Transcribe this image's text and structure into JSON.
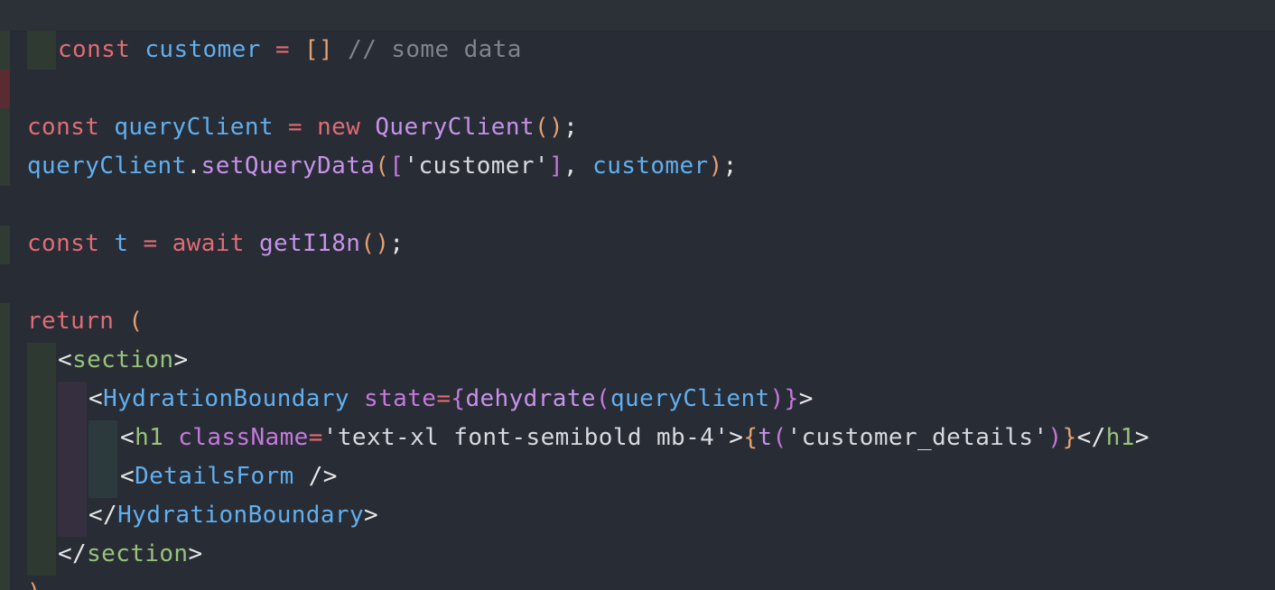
{
  "editor": {
    "language_hint_colors": {
      "background": "#282c34",
      "keyword": "#e06c75",
      "identifier": "#61afef",
      "function": "#c792ea",
      "string": "#d7dae0",
      "comment": "#7f848e",
      "tag": "#98c379"
    },
    "lines": [
      {
        "tokens": [
          {
            "t": "const",
            "c": "kw"
          },
          {
            "t": " ",
            "c": "punc"
          },
          {
            "t": "customer",
            "c": "var"
          },
          {
            "t": " ",
            "c": "punc"
          },
          {
            "t": "=",
            "c": "op"
          },
          {
            "t": " ",
            "c": "punc"
          },
          {
            "t": "[]",
            "c": "brk"
          },
          {
            "t": " ",
            "c": "punc"
          },
          {
            "t": "// some data",
            "c": "cmt"
          }
        ]
      },
      {
        "tokens": []
      },
      {
        "tokens": [
          {
            "t": "const",
            "c": "kw"
          },
          {
            "t": " ",
            "c": "punc"
          },
          {
            "t": "queryClient",
            "c": "var"
          },
          {
            "t": " ",
            "c": "punc"
          },
          {
            "t": "=",
            "c": "op"
          },
          {
            "t": " ",
            "c": "punc"
          },
          {
            "t": "new",
            "c": "kw"
          },
          {
            "t": " ",
            "c": "punc"
          },
          {
            "t": "QueryClient",
            "c": "fn"
          },
          {
            "t": "()",
            "c": "brk"
          },
          {
            "t": ";",
            "c": "white"
          }
        ]
      },
      {
        "tokens": [
          {
            "t": "queryClient",
            "c": "var"
          },
          {
            "t": ".",
            "c": "white"
          },
          {
            "t": "setQueryData",
            "c": "fn"
          },
          {
            "t": "(",
            "c": "brk"
          },
          {
            "t": "[",
            "c": "brk2"
          },
          {
            "t": "'customer'",
            "c": "str2"
          },
          {
            "t": "]",
            "c": "brk2"
          },
          {
            "t": ", ",
            "c": "white"
          },
          {
            "t": "customer",
            "c": "var"
          },
          {
            "t": ")",
            "c": "brk"
          },
          {
            "t": ";",
            "c": "white"
          }
        ]
      },
      {
        "tokens": []
      },
      {
        "tokens": [
          {
            "t": "const",
            "c": "kw"
          },
          {
            "t": " ",
            "c": "punc"
          },
          {
            "t": "t",
            "c": "var"
          },
          {
            "t": " ",
            "c": "punc"
          },
          {
            "t": "=",
            "c": "op"
          },
          {
            "t": " ",
            "c": "punc"
          },
          {
            "t": "await",
            "c": "kw"
          },
          {
            "t": " ",
            "c": "punc"
          },
          {
            "t": "getI18n",
            "c": "fn"
          },
          {
            "t": "()",
            "c": "brk"
          },
          {
            "t": ";",
            "c": "white"
          }
        ]
      },
      {
        "tokens": []
      },
      {
        "tokens": [
          {
            "t": "return",
            "c": "kw"
          },
          {
            "t": " ",
            "c": "punc"
          },
          {
            "t": "(",
            "c": "brk"
          }
        ]
      },
      {
        "tokens": [
          {
            "t": "<",
            "c": "white"
          },
          {
            "t": "section",
            "c": "tag"
          },
          {
            "t": ">",
            "c": "white"
          }
        ]
      },
      {
        "tokens": [
          {
            "t": "<",
            "c": "white"
          },
          {
            "t": "HydrationBoundary",
            "c": "tag2"
          },
          {
            "t": " ",
            "c": "punc"
          },
          {
            "t": "state",
            "c": "attr"
          },
          {
            "t": "=",
            "c": "op"
          },
          {
            "t": "{",
            "c": "brk2"
          },
          {
            "t": "dehydrate",
            "c": "fn"
          },
          {
            "t": "(",
            "c": "brk2"
          },
          {
            "t": "queryClient",
            "c": "var"
          },
          {
            "t": ")",
            "c": "brk2"
          },
          {
            "t": "}",
            "c": "brk2"
          },
          {
            "t": ">",
            "c": "white"
          }
        ]
      },
      {
        "tokens": [
          {
            "t": "<",
            "c": "white"
          },
          {
            "t": "h1",
            "c": "tag"
          },
          {
            "t": " ",
            "c": "punc"
          },
          {
            "t": "className",
            "c": "attr"
          },
          {
            "t": "=",
            "c": "op"
          },
          {
            "t": "'text-xl font-semibold mb-4'",
            "c": "str2"
          },
          {
            "t": ">",
            "c": "white"
          },
          {
            "t": "{",
            "c": "brk"
          },
          {
            "t": "t",
            "c": "fn"
          },
          {
            "t": "(",
            "c": "brk2"
          },
          {
            "t": "'customer_details'",
            "c": "str2"
          },
          {
            "t": ")",
            "c": "brk2"
          },
          {
            "t": "}",
            "c": "brk"
          },
          {
            "t": "</",
            "c": "white"
          },
          {
            "t": "h1",
            "c": "tag"
          },
          {
            "t": ">",
            "c": "white"
          }
        ]
      },
      {
        "tokens": [
          {
            "t": "<",
            "c": "white"
          },
          {
            "t": "DetailsForm",
            "c": "tag2"
          },
          {
            "t": " />",
            "c": "white"
          }
        ]
      },
      {
        "tokens": [
          {
            "t": "</",
            "c": "white"
          },
          {
            "t": "HydrationBoundary",
            "c": "tag2"
          },
          {
            "t": ">",
            "c": "white"
          }
        ]
      },
      {
        "tokens": [
          {
            "t": "</",
            "c": "white"
          },
          {
            "t": "section",
            "c": "tag"
          },
          {
            "t": ">",
            "c": "white"
          }
        ]
      },
      {
        "tokens": [
          {
            "t": ")",
            "c": "brk"
          }
        ]
      }
    ]
  }
}
